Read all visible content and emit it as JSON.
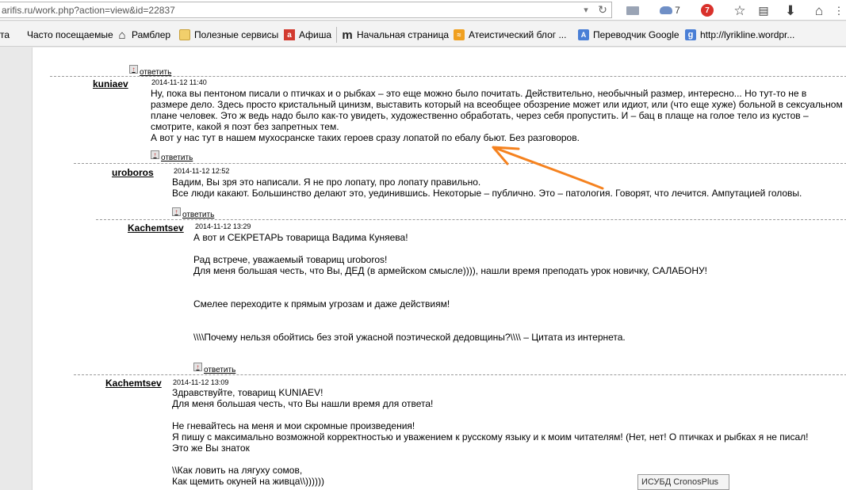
{
  "browser": {
    "url": "arifis.ru/work.php?action=view&id=22837",
    "cloud_count": "7",
    "notification_count": "7"
  },
  "bookmarks": [
    {
      "label": "та",
      "icon": "none"
    },
    {
      "label": "Часто посещаемые",
      "icon": "none"
    },
    {
      "label": "Рамблер",
      "icon": "house-icon"
    },
    {
      "label": "Полезные сервисы",
      "icon": "folder-icon"
    },
    {
      "label": "Афиша",
      "icon": "afisha-icon"
    },
    {
      "label": "Начальная страница",
      "icon": "m-icon"
    },
    {
      "label": "Атеистический блог ...",
      "icon": "rss-icon"
    },
    {
      "label": "Переводчик Google",
      "icon": "translate-icon"
    },
    {
      "label": "http://lyrikline.wordpr...",
      "icon": "google-icon"
    }
  ],
  "reply_label": "ответить",
  "comments": [
    {
      "author": "kuniaev",
      "date": "2014-11-12 11:40",
      "lines": [
        "Ну, пока вы пентоном писали о птичках и о рыбках – это еще можно было почитать. Действительно, необычный размер, интересно... Но тут-то не в размере дело. Здесь просто кристальный цинизм, выставить который на всеобщее обозрение может или идиот, или (что еще хуже) больной в сексуальном плане человек. Это ж ведь надо было как-то увидеть, художественно обработать, через себя пропустить. И – бац в плаще на голое тело из кустов – смотрите, какой я поэт без запретных тем.",
        "А вот у нас тут в нашем мухосранске таких героев сразу лопатой по ебалу бьют. Без разговоров."
      ]
    },
    {
      "author": "uroboros",
      "date": "2014-11-12 12:52",
      "lines": [
        "Вадим, Вы зря это написали. Я не про лопату, про лопату правильно.",
        "Все люди какают. Большинство делают это, уединившись. Некоторые – публично. Это – патология. Говорят, что лечится. Ампутацией головы."
      ]
    },
    {
      "author": "Kachemtsev",
      "date": "2014-11-12 13:29",
      "lines": [
        "А вот и СЕКРЕТАРЬ товарища Вадима Куняева!",
        "",
        "Рад встрече, уважаемый товарищ uroboros!",
        "Для меня большая честь, что Вы, ДЕД (в армейском смысле)))), нашли время преподать урок новичку, САЛАБОНУ!",
        "",
        "",
        "Смелее переходите к прямым угрозам и даже действиям!",
        "",
        "",
        "\\\\\\\\Почему нельзя обойтись без этой ужасной поэтической дедовщины?\\\\\\\\ – Цитата из интернета."
      ]
    },
    {
      "author": "Kachemtsev",
      "date": "2014-11-12 13:09",
      "lines": [
        "Здравствуйте, товарищ KUNIAEV!",
        "Для меня большая честь, что Вы нашли время для ответа!",
        "",
        "Не гневайтесь на меня и мои скромные произведения!",
        "Я пишу с максимально возможной корректностью и уважением к русскому языку и к моим читателям! (Нет, нет! О птичках и рыбках я не писал!",
        "Это же Вы знаток",
        "",
        "\\\\Как ловить на лягуху сомов,",
        "Как щемить окуней на живца\\\\))))))"
      ]
    }
  ],
  "tooltip": "ИСУБД CronosPlus",
  "annotation_color": "#f5821f"
}
